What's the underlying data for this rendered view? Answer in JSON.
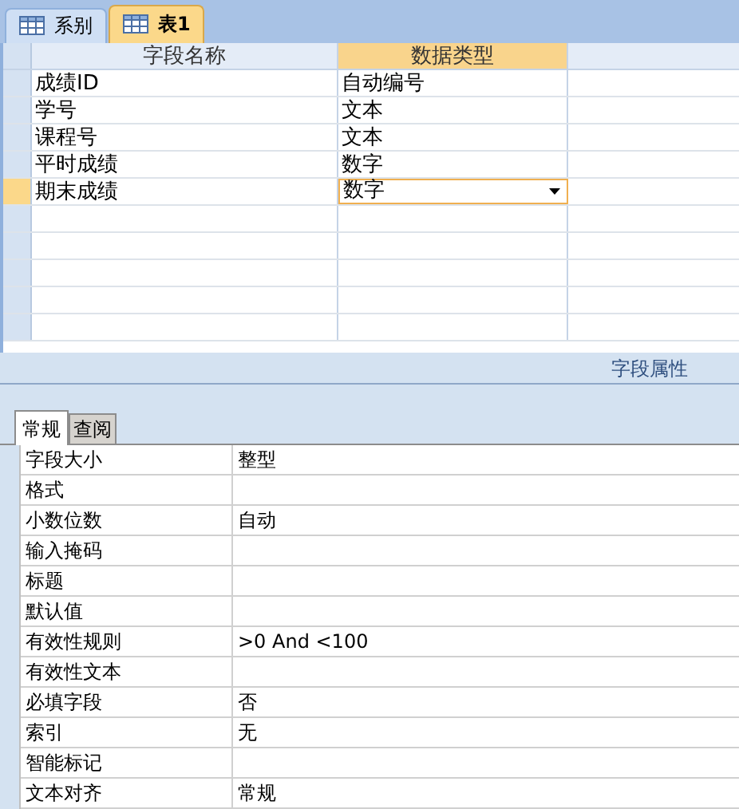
{
  "tabs": [
    {
      "label": "系别",
      "selected": false
    },
    {
      "label": "表1",
      "selected": true
    }
  ],
  "design_grid": {
    "columns": [
      "字段名称",
      "数据类型"
    ],
    "rows": [
      {
        "field_name": "成绩ID",
        "data_type": "自动编号",
        "selected": false
      },
      {
        "field_name": "学号",
        "data_type": "文本",
        "selected": false
      },
      {
        "field_name": "课程号",
        "data_type": "文本",
        "selected": false
      },
      {
        "field_name": "平时成绩",
        "data_type": "数字",
        "selected": false
      },
      {
        "field_name": "期末成绩",
        "data_type": "数字",
        "selected": true
      }
    ]
  },
  "field_properties": {
    "title": "字段属性",
    "tabs": [
      {
        "label": "常规",
        "selected": true
      },
      {
        "label": "查阅",
        "selected": false
      }
    ],
    "properties": [
      {
        "label": "字段大小",
        "value": "整型"
      },
      {
        "label": "格式"
      },
      {
        "label": "小数位数",
        "value": "自动"
      },
      {
        "label": "输入掩码"
      },
      {
        "label": "标题"
      },
      {
        "label": "默认值"
      },
      {
        "label": "有效性规则",
        "value": ">0 And <100"
      },
      {
        "label": "有效性文本"
      },
      {
        "label": "必填字段",
        "value": "否"
      },
      {
        "label": "索引",
        "value": "无"
      },
      {
        "label": "智能标记"
      },
      {
        "label": "文本对齐",
        "value": "常规"
      }
    ]
  }
}
